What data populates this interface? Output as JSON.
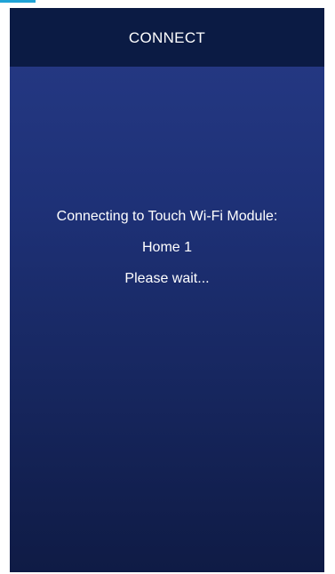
{
  "header": {
    "title": "CONNECT"
  },
  "connection": {
    "status_text": "Connecting to Touch Wi-Fi Module:",
    "network_name": "Home 1",
    "wait_text": "Please wait..."
  },
  "colors": {
    "accent": "#1fa3d6",
    "header_background": "#0b1b44",
    "screen_gradient_top": "#263a86",
    "screen_gradient_bottom": "#0f1b45",
    "text": "#ffffff"
  }
}
